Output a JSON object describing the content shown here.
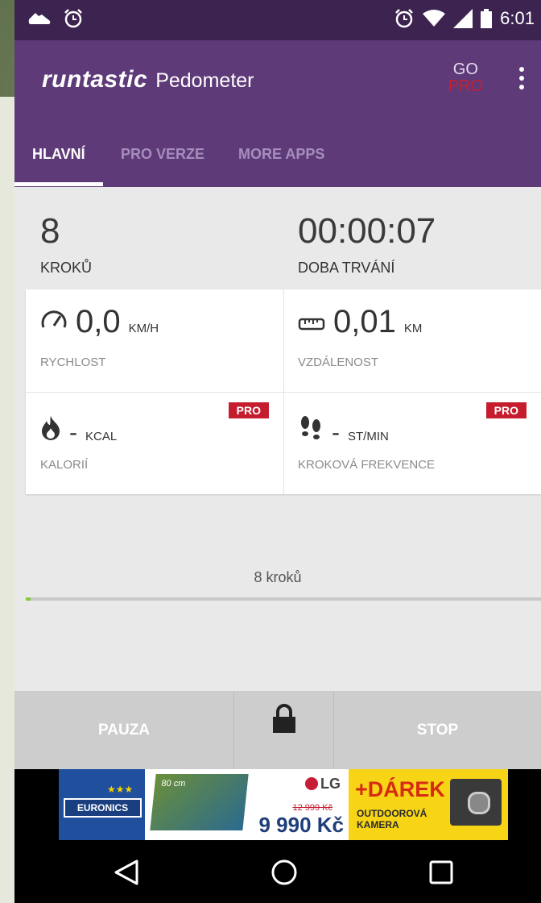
{
  "status_bar": {
    "time": "6:01"
  },
  "app_bar": {
    "brand": "runtastic",
    "product": "Pedometer",
    "go_label": "GO",
    "pro_label": "PRO"
  },
  "tabs": [
    {
      "label": "HLAVNÍ",
      "active": true
    },
    {
      "label": "PRO VERZE",
      "active": false
    },
    {
      "label": "MORE APPS",
      "active": false
    }
  ],
  "summary": {
    "steps_value": "8",
    "steps_label": "KROKŮ",
    "duration_value": "00:00:07",
    "duration_label": "DOBA TRVÁNÍ"
  },
  "metrics": {
    "speed": {
      "value": "0,0",
      "unit": "KM/H",
      "label": "RYCHLOST",
      "icon": "speedometer-icon"
    },
    "distance": {
      "value": "0,01",
      "unit": "KM",
      "label": "VZDÁLENOST",
      "icon": "ruler-icon"
    },
    "calories": {
      "value": "-",
      "unit": "KCAL",
      "label": "KALORIÍ",
      "icon": "flame-icon",
      "badge": "PRO"
    },
    "cadence": {
      "value": "-",
      "unit": "ST/MIN",
      "label": "KROKOVÁ FREKVENCE",
      "icon": "footsteps-icon",
      "badge": "PRO"
    }
  },
  "progress": {
    "label": "8 kroků",
    "fraction": 0.01
  },
  "bottom_bar": {
    "pause_label": "PAUZA",
    "stop_label": "STOP",
    "lock_icon": "lock-icon"
  },
  "ad": {
    "euronics": "EURONICS",
    "tv_size": "80 cm",
    "brand": "LG",
    "old_price": "12 999 Kč",
    "price": "9 990 Kč",
    "gift": "+DÁREK",
    "gift_line1": "OUTDOOROVÁ",
    "gift_line2": "KAMERA"
  },
  "colors": {
    "primary": "#5e3a78",
    "status_bar": "#3d2350",
    "accent_red": "#c51d2e",
    "progress_green": "#8cc63f"
  }
}
